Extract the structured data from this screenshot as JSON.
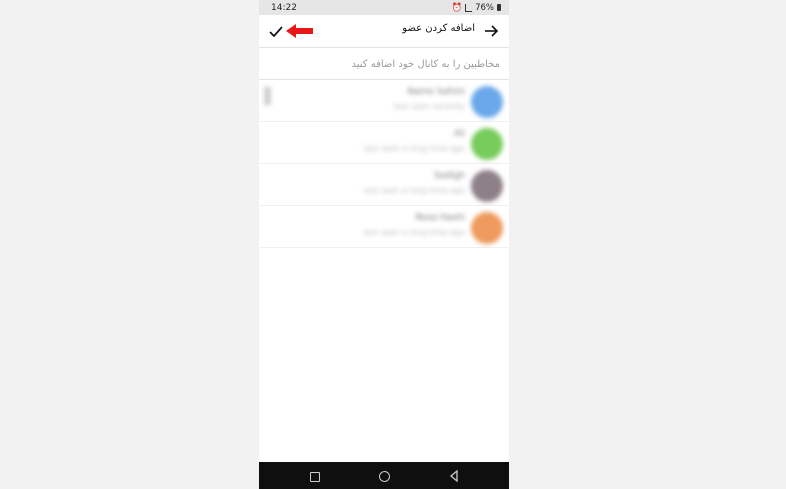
{
  "status_bar": {
    "time": "14:22",
    "battery": "76%"
  },
  "app_bar": {
    "title": "اضافه کردن عضو",
    "back_icon": "arrow-right-icon",
    "confirm_icon": "checkmark-icon"
  },
  "search": {
    "placeholder": "مخاطبین را به کانال خود اضافه کنید",
    "value": ""
  },
  "contacts": [
    {
      "name": "Name Sahim",
      "subtitle": "last seen recently",
      "avatar_color": "#6aa8ea"
    },
    {
      "name": "Ali",
      "subtitle": "last seen a long time ago",
      "avatar_color": "#78cc5c"
    },
    {
      "name": "Sadigh",
      "subtitle": "last seen a long time ago",
      "avatar_color": "#8e8088"
    },
    {
      "name": "Reza Hashi",
      "subtitle": "last seen a long time ago",
      "avatar_color": "#ef9a5e"
    }
  ],
  "annotation": {
    "arrow_color": "#e81818"
  },
  "nav_bar": {
    "icons": [
      "recent-apps-icon",
      "home-icon",
      "back-triangle-icon"
    ]
  }
}
